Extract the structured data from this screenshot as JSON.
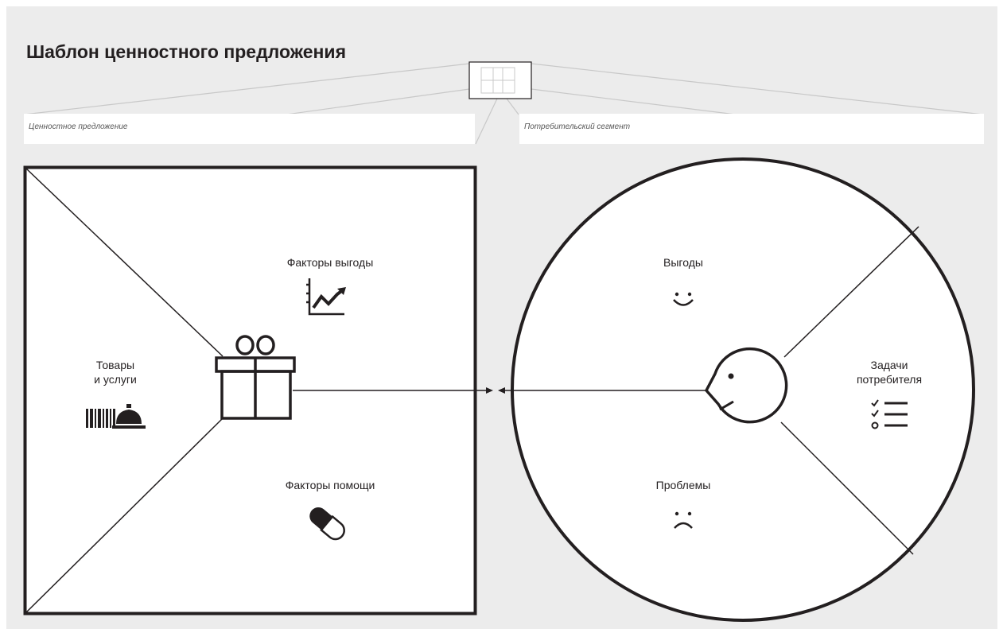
{
  "title": "Шаблон ценностного предложения",
  "fields": {
    "value_proposition": "Ценностное предложение",
    "customer_segment": "Потребительский сегмент"
  },
  "value_map": {
    "gain_creators": "Факторы выгоды",
    "products_services_line1": "Товары",
    "products_services_line2": "и услуги",
    "pain_relievers": "Факторы помощи",
    "icons": [
      "growth-chart-icon",
      "gift-icon",
      "barcode-icon",
      "service-bell-icon",
      "pill-icon"
    ]
  },
  "customer_profile": {
    "gains": "Выгоды",
    "jobs_line1": "Задачи",
    "jobs_line2": "потребителя",
    "pains": "Проблемы",
    "icons": [
      "smile-icon",
      "face-icon",
      "checklist-icon",
      "frown-icon"
    ]
  },
  "colors": {
    "background": "#ececec",
    "ink": "#231f20",
    "thumbnail_line": "#c8c8c8"
  }
}
